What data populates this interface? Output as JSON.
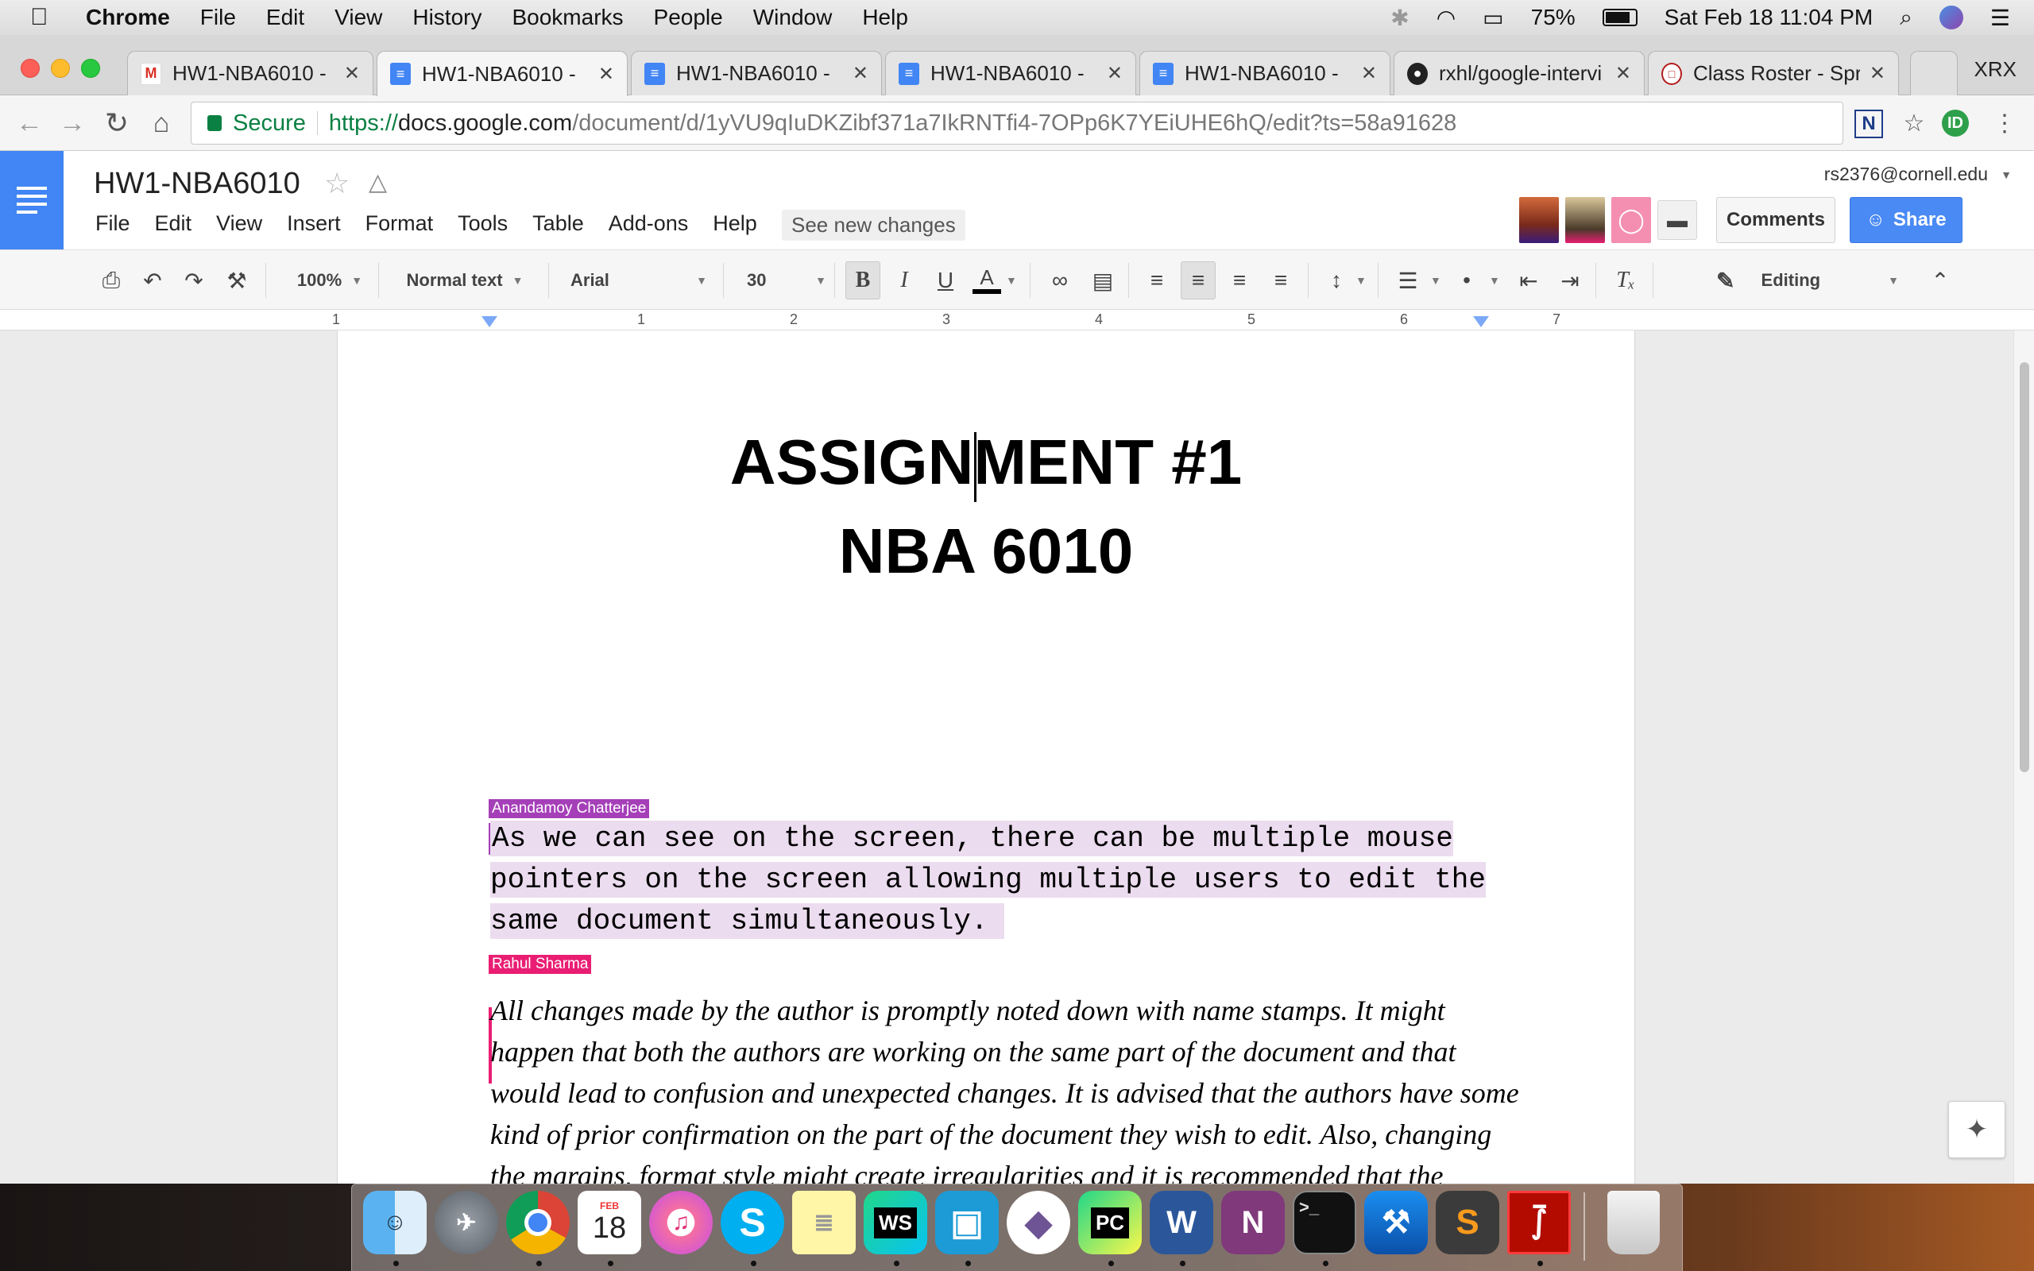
{
  "menubar": {
    "app": "Chrome",
    "items": [
      "File",
      "Edit",
      "View",
      "History",
      "Bookmarks",
      "People",
      "Window",
      "Help"
    ],
    "battery": "75%",
    "clock": "Sat Feb 18  11:04 PM"
  },
  "tabs": [
    {
      "title": "HW1-NBA6010 - ",
      "icon": "gmail-icon"
    },
    {
      "title": "HW1-NBA6010 - ",
      "icon": "docs-icon"
    },
    {
      "title": "HW1-NBA6010 - ",
      "icon": "docs-icon"
    },
    {
      "title": "HW1-NBA6010 - ",
      "icon": "docs-icon"
    },
    {
      "title": "HW1-NBA6010 - ",
      "icon": "docs-icon"
    },
    {
      "title": "rxhl/google-intervi",
      "icon": "github-icon"
    },
    {
      "title": "Class Roster - Spri",
      "icon": "cornell-icon"
    }
  ],
  "profile_label": "XRX",
  "omnibox": {
    "secure_label": "Secure",
    "scheme": "https://",
    "host": "docs.google.com",
    "path": "/document/d/1yVU9qIuDKZibf371a7IkRNTfi4-7OPp6K7YEiUHE6hQ/edit?ts=58a91628"
  },
  "docs": {
    "title": "HW1-NBA6010",
    "menu": [
      "File",
      "Edit",
      "View",
      "Insert",
      "Format",
      "Tools",
      "Table",
      "Add-ons",
      "Help"
    ],
    "see_new_changes": "See new changes",
    "user_email": "rs2376@cornell.edu",
    "comments_label": "Comments",
    "share_label": "Share",
    "toolbar": {
      "zoom": "100%",
      "style": "Normal text",
      "font": "Arial",
      "size": "30",
      "mode": "Editing"
    },
    "ruler_numbers": [
      "1",
      "1",
      "2",
      "3",
      "4",
      "5",
      "6",
      "7"
    ]
  },
  "document": {
    "title_line1": "ASSIGNMENT #1",
    "title_line2": "NBA 6010",
    "collaborator1": {
      "name": "Anandamoy Chatterjee",
      "color": "#a53fb8"
    },
    "para1": "As we can see on the screen, there can be multiple mouse pointers on the screen allowing multiple users to edit the same document simultaneously.",
    "collaborator2": {
      "name": "Rahul Sharma",
      "color": "#e91e73"
    },
    "para2": "All changes made by the author is promptly noted down with name stamps. It might happen that both the authors are working on the same part of the document and that would lead to confusion and unexpected changes. It is advised that the authors have some kind of prior confirmation on the part of the document they wish to edit. Also, changing the margins, format style might create irregularities and it is recommended that the authors agree to a specific style format font and margin layout."
  },
  "dock": {
    "calendar_month": "FEB",
    "calendar_day": "18",
    "apps": [
      "finder-icon",
      "launchpad-icon",
      "chrome-icon",
      "calendar-icon",
      "itunes-icon",
      "skype-icon",
      "notes-icon",
      "webstorm-icon",
      "app-icon",
      "github-desktop-icon",
      "pycharm-icon",
      "word-icon",
      "onenote-icon",
      "terminal-icon",
      "xcode-icon",
      "sublime-icon",
      "acrobat-icon",
      "trash-icon"
    ]
  }
}
